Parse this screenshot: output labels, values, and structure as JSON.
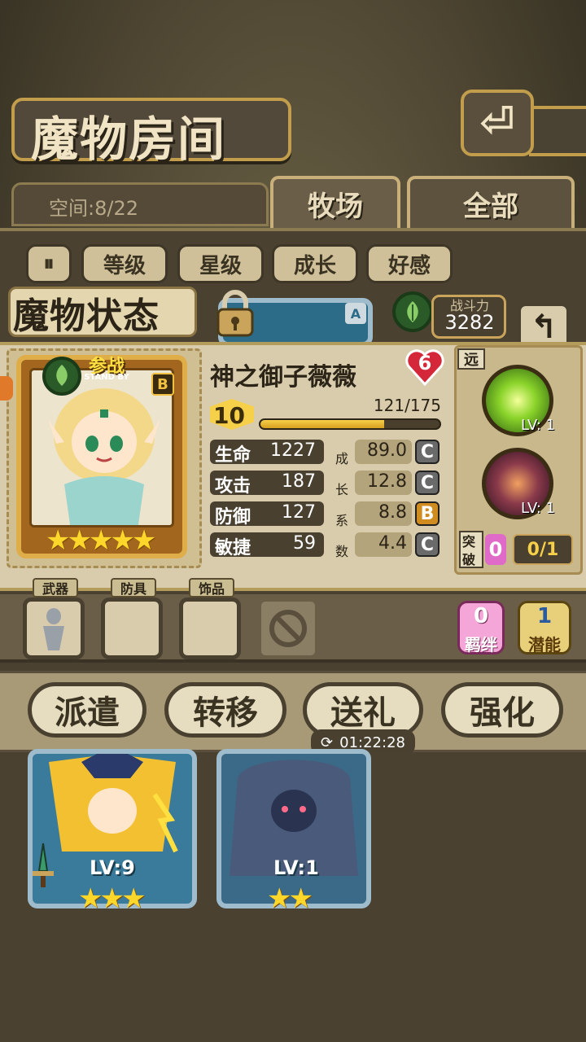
{
  "page": {
    "title": "魔物房间",
    "capacity": "空间:8/22"
  },
  "tabs": [
    {
      "label": "牧场"
    },
    {
      "label": "全部"
    }
  ],
  "filters": [
    "等级",
    "星级",
    "成长",
    "好感"
  ],
  "status": {
    "title": "魔物状态",
    "power_label": "战斗力",
    "power_value": "3282"
  },
  "monster": {
    "badge": "参战",
    "badge_sub": "STAND BY",
    "rank": "B",
    "name": "神之御子薇薇",
    "affection": "6",
    "level": "10",
    "exp": "121/175",
    "exp_fraction": 0.69,
    "stars": 5
  },
  "stats": [
    {
      "label": "生命",
      "value": "1227",
      "growth": "89.0",
      "grade": "C"
    },
    {
      "label": "攻击",
      "value": "187",
      "growth": "12.8",
      "grade": "C"
    },
    {
      "label": "防御",
      "value": "127",
      "growth": "8.8",
      "grade": "B"
    },
    {
      "label": "敏捷",
      "value": "59",
      "growth": "4.4",
      "grade": "C"
    }
  ],
  "growth_chars": [
    "成",
    "长",
    "系",
    "数"
  ],
  "skills": {
    "range": "远",
    "items": [
      {
        "icon": "light-burst-icon",
        "level": "LV: 1"
      },
      {
        "icon": "dark-fist-icon",
        "level": "LV: 1"
      }
    ],
    "break_label1": "突",
    "break_label2": "破",
    "break_current": "0",
    "break_progress": "0/1"
  },
  "equipment": {
    "weapon": "武器",
    "armor": "防具",
    "accessory": "饰品"
  },
  "bond": {
    "value": "0",
    "label": "羁绊"
  },
  "potential": {
    "value": "1",
    "label": "潜能"
  },
  "actions": [
    "派遣",
    "转移",
    "送礼",
    "强化"
  ],
  "timer": "01:22:28",
  "list": [
    {
      "tag": "A"
    },
    {
      "level": "LV:9"
    },
    {
      "level": "LV:1"
    }
  ],
  "colors": {
    "gold": "#c9a45a",
    "panel": "#d8ccac",
    "dark": "#4a4030"
  }
}
